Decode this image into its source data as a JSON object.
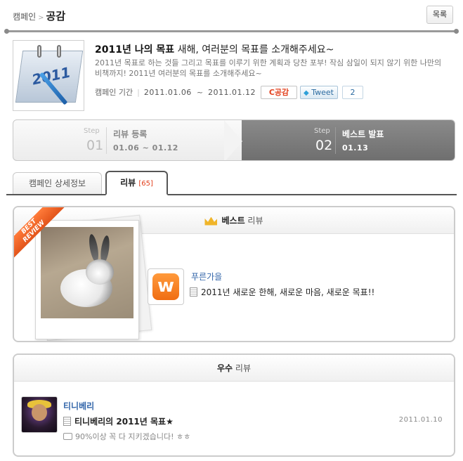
{
  "header": {
    "breadcrumb_parent": "캠페인",
    "breadcrumb_sep": ">",
    "breadcrumb_current": "공감",
    "list_button": "목록"
  },
  "campaign": {
    "thumb_year": "2011",
    "title_main": "2011년 나의 목표",
    "title_sub": " 새해, 여러분의 목표를 소개해주세요~",
    "description": "2011년 목표로 하는 것들 그리고 목표를 이루기 위한 계획과 당찬 포부! 작심 삼일이 되지 않기 위한 나만의 비책까지! 2011년 여러분의 목표를 소개해주세요~",
    "period_label": "캠페인 기간",
    "start_date": "2011.01.06",
    "tilde": "~",
    "end_date": "2011.01.12",
    "gonggam_label": "공감",
    "tweet_label": "Tweet",
    "tweet_count": "2"
  },
  "steps": [
    {
      "label": "Step",
      "num": "01",
      "name": "리뷰 등록",
      "date": "01.06 ~ 01.12"
    },
    {
      "label": "Step",
      "num": "02",
      "name": "베스트 발표",
      "date": "01.13"
    }
  ],
  "tabs": {
    "detail": "캠페인 상세정보",
    "review": "리뷰",
    "review_count": "[65]"
  },
  "best_review": {
    "head_bold": "베스트",
    "head_rest": " 리뷰",
    "ribbon_line1": "BEST",
    "ribbon_line2": "REVIEW",
    "avatar_letter": "w",
    "user": "푸른가을",
    "title": "2011년 새로운 한해, 새로운 마음, 새로운 목표!!"
  },
  "good_review": {
    "head_bold": "우수",
    "head_rest": " 리뷰",
    "user": "티니베리",
    "title": "티니베리의 2011년 목표★",
    "comment": "90%이상 꼭 다 지키겠습니다! ㅎㅎ",
    "date": "2011.01.10"
  },
  "colors": {
    "accent_orange": "#e2401d",
    "link_blue": "#3366aa",
    "step_active_bg": "#7a7a7a"
  }
}
